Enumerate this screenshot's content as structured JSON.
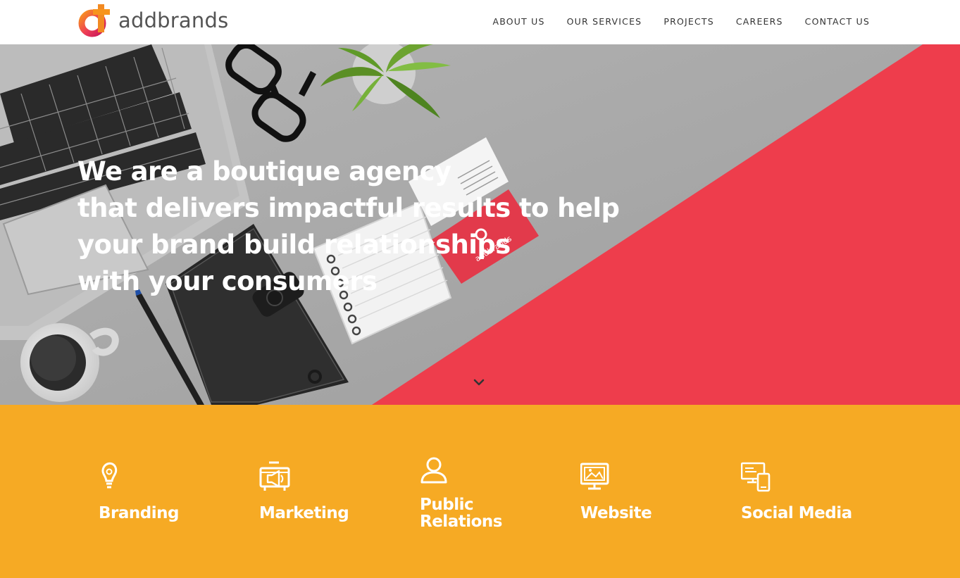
{
  "header": {
    "logo_text": "addbrands",
    "nav": [
      {
        "label": "ABOUT US"
      },
      {
        "label": "OUR SERVICES"
      },
      {
        "label": "PROJECTS"
      },
      {
        "label": "CAREERS"
      },
      {
        "label": "CONTACT US"
      }
    ]
  },
  "hero": {
    "headline_lines": [
      "We are a boutique agency",
      "that delivers impactful results to help",
      "your brand build relationships",
      "with your consumers"
    ],
    "scroll_icon": "chevron-down-icon",
    "card_text": "addbrands"
  },
  "services": [
    {
      "label": "Branding",
      "icon": "lightbulb-icon"
    },
    {
      "label": "Marketing",
      "icon": "megaphone-icon"
    },
    {
      "label": "Public Relations",
      "icon": "person-icon"
    },
    {
      "label": "Website",
      "icon": "monitor-icon"
    },
    {
      "label": "Social Media",
      "icon": "devices-icon"
    }
  ],
  "colors": {
    "brand_pink": "#e8345a",
    "brand_orange": "#f7941d",
    "hero_red": "#ee3d4c",
    "services_yellow": "#f6aa24",
    "desk_gray": "#a9a9a9",
    "nav_text": "#333333"
  }
}
